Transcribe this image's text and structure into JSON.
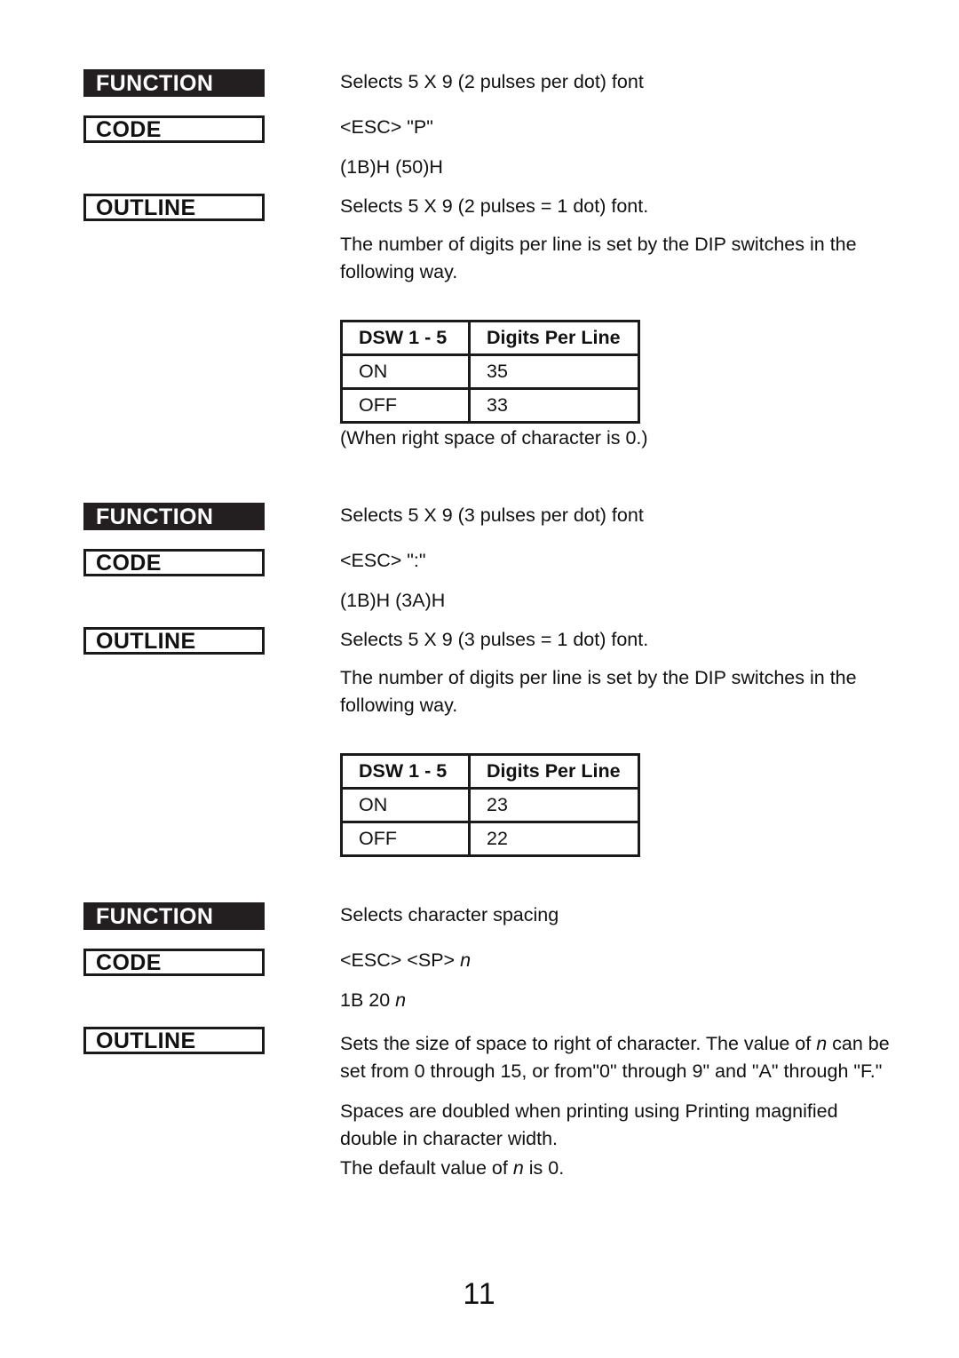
{
  "page": {
    "number": "11"
  },
  "labels": {
    "function": "FUNCTION",
    "code": "CODE",
    "outline": "OUTLINE"
  },
  "table_headers": {
    "dsw": "DSW 1 - 5",
    "digits": "Digits Per Line"
  },
  "sections": [
    {
      "function_text": "Selects 5 X 9 (2 pulses per dot) font",
      "code_text": "<ESC> \"P\"",
      "code_hex": "(1B)H (50)H",
      "outline_text": "Selects 5 X 9 (2 pulses = 1 dot) font.",
      "dip_paragraph": "The number of digits per line is set by the DIP switches in the following way.",
      "table": {
        "headers": [
          "DSW 1 - 5",
          "Digits Per Line"
        ],
        "rows": [
          {
            "dsw": "ON",
            "digits": "35"
          },
          {
            "dsw": "OFF",
            "digits": "33"
          }
        ]
      },
      "note": "(When right space of character is 0.)"
    },
    {
      "function_text": "Selects 5 X 9 (3 pulses per dot) font",
      "code_text": "<ESC> \":\"",
      "code_hex": "(1B)H (3A)H",
      "outline_text": "Selects 5 X 9 (3 pulses = 1 dot) font.",
      "dip_paragraph": "The number of digits per line is set by the DIP switches in the following way.",
      "table": {
        "headers": [
          "DSW 1 - 5",
          "Digits Per Line"
        ],
        "rows": [
          {
            "dsw": "ON",
            "digits": "23"
          },
          {
            "dsw": "OFF",
            "digits": "22"
          }
        ]
      }
    },
    {
      "function_text": "Selects character spacing",
      "code_text_pre": "<ESC> <SP> ",
      "code_text_italic": "n",
      "code_hex_pre": "1B 20 ",
      "code_hex_italic": "n",
      "outline_a_pre": "Sets the size of space to right of character.  The value of ",
      "outline_a_italic": "n",
      "outline_a_post": " can be set from 0 through 15, or from\"0\" through 9\" and \"A\" through \"F.\"",
      "outline_b": "Spaces are doubled when printing using Printing magnified double in character width.",
      "outline_c_pre": "The default value of ",
      "outline_c_italic": "n",
      "outline_c_post": " is 0."
    }
  ]
}
